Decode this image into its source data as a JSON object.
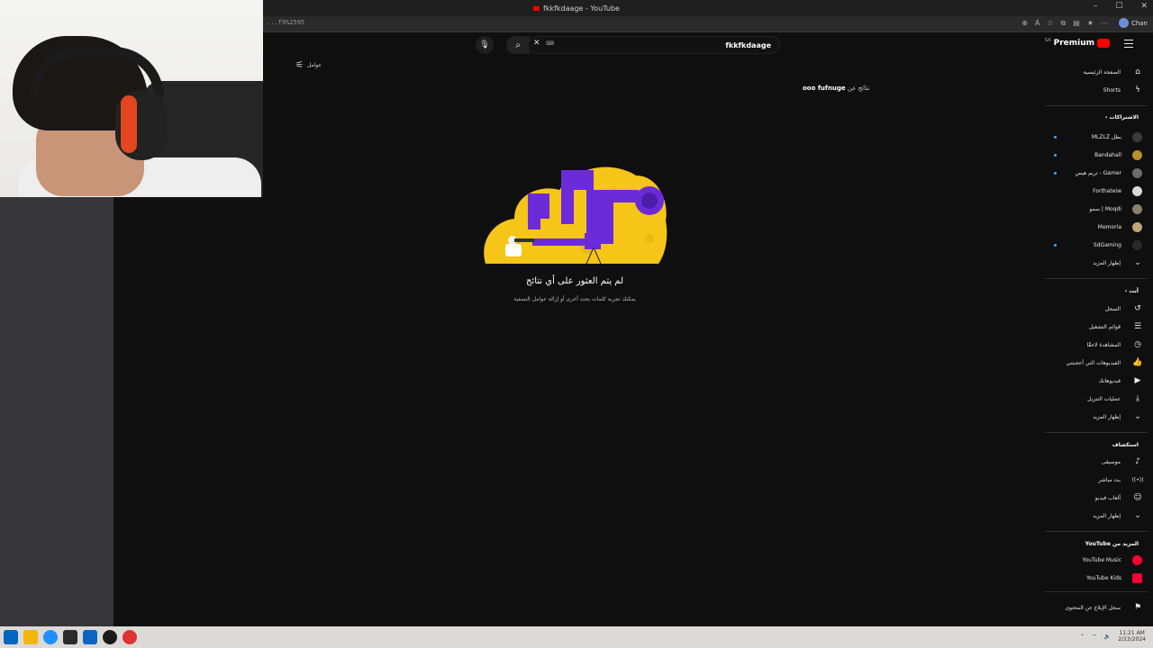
{
  "browser": {
    "title": "fkkfkdaage - YouTube",
    "url": "...f9%2595",
    "profile_name": "Chan",
    "window_controls": [
      "–",
      "☐",
      "✕"
    ]
  },
  "youtube": {
    "logo_text": "Premium",
    "logo_badge": "SA",
    "search": {
      "value": "fkkfkdaage",
      "clear_icon": "✕",
      "search_icon": "⌕",
      "mic_icon": "🎙"
    },
    "filters_label": "عوامل",
    "results_for": "نتائج عن",
    "results_query": "ooo fufnuge",
    "empty_state": {
      "title": "لم يتم العثور على أي نتائج",
      "subtitle": "يمكنك تجربة كلمات بحث أخرى أو إزالة عوامل التصفية"
    }
  },
  "sidebar": {
    "main": [
      {
        "label": "الصفحة الرئيسية",
        "icon": "⌂",
        "name": "home"
      },
      {
        "label": "Shorts",
        "icon": "ϟ",
        "name": "shorts"
      }
    ],
    "subscriptions_header": "الاشتراكات ›",
    "subscriptions": [
      {
        "label": "بطل MLZLZ",
        "color": "#3a3a3a",
        "dot": true
      },
      {
        "label": "Bandahall",
        "color": "#b8922c",
        "dot": false
      },
      {
        "label": "Gamer - تريم هيس",
        "color": "#6b6b6b",
        "dot": true
      },
      {
        "label": "Forthateiw",
        "color": "#d8d8d8",
        "dot": false
      },
      {
        "label": "Moqdi | سمو",
        "color": "#8a7f6c",
        "dot": false
      },
      {
        "label": "Memoria",
        "color": "#c3a37a",
        "dot": false
      },
      {
        "label": "SdGaming",
        "color": "#292929",
        "dot": true
      },
      {
        "label": "إظهار المزيد",
        "icon": "⌄"
      }
    ],
    "you_header": "أنت ›",
    "you": [
      {
        "label": "السجل",
        "icon": "↺",
        "name": "history"
      },
      {
        "label": "قوائم التشغيل",
        "icon": "☰",
        "name": "playlists"
      },
      {
        "label": "المشاهدة لاحقًا",
        "icon": "◷",
        "name": "watch-later"
      },
      {
        "label": "الفيديوهات التي أعجبتني",
        "icon": "👍",
        "name": "liked"
      },
      {
        "label": "فيديوهاتك",
        "icon": "▶",
        "name": "your-videos"
      },
      {
        "label": "عمليات التنزيل",
        "icon": "⤓",
        "name": "downloads"
      },
      {
        "label": "إظهار المزيد",
        "icon": "⌄",
        "name": "show-more-you"
      }
    ],
    "explore_header": "استكشاف",
    "explore": [
      {
        "label": "موسيقى",
        "icon": "♪",
        "name": "music"
      },
      {
        "label": "بث مباشر",
        "icon": "((•))",
        "name": "live"
      },
      {
        "label": "ألعاب فيديو",
        "icon": "☺",
        "name": "gaming"
      },
      {
        "label": "إظهار المزيد",
        "icon": "⌄",
        "name": "show-more-explore"
      }
    ],
    "more_header": "المزيد من YouTube",
    "more": [
      {
        "label": "YouTube Music",
        "name": "yt-music"
      },
      {
        "label": "YouTube Kids",
        "name": "yt-kids"
      }
    ],
    "report_history": "سجل الإبلاغ عن المحتوى",
    "report_icon": "⚑"
  },
  "taskbar": {
    "time": "11:21 AM",
    "date": "2/23/2024",
    "icon_colors": [
      "#0067c0",
      "#f2b705",
      "#1e90ff",
      "#2b2b2b",
      "#0a66c2",
      "#1b1b1b",
      "#d33"
    ]
  }
}
